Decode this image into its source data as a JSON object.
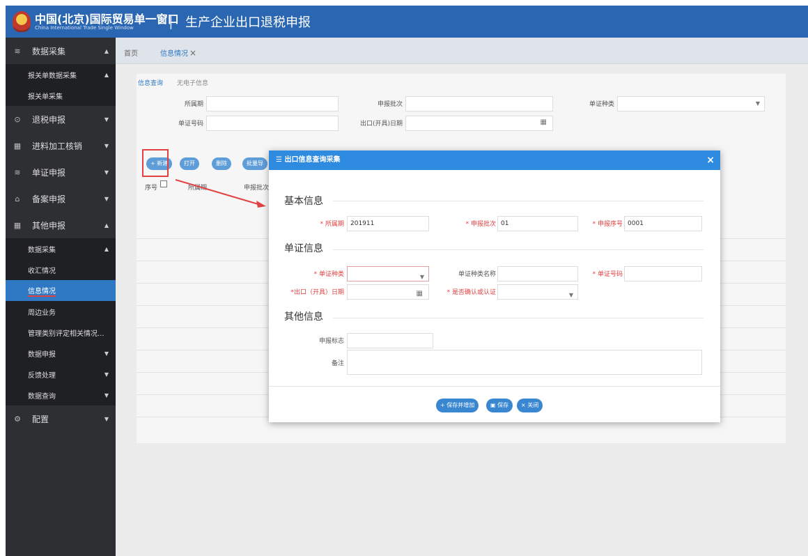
{
  "header": {
    "brand_cn": "中国(北京)国际贸易单一窗口",
    "brand_en": "China International Trade Single Window",
    "separator": "|",
    "subtitle": "生产企业出口退税申报"
  },
  "sidebar": {
    "items": [
      {
        "label": "数据采集",
        "level": 1,
        "icon": "database-icon",
        "arrow": "▲"
      },
      {
        "label": "报关单数据采集",
        "level": 2,
        "arrow": "▲"
      },
      {
        "label": "报关单采集",
        "level": 2
      },
      {
        "label": "退税申报",
        "level": 1,
        "icon": "refund-icon",
        "arrow": "▼"
      },
      {
        "label": "进料加工核销",
        "level": 1,
        "icon": "grid-icon",
        "arrow": "▼"
      },
      {
        "label": "单证申报",
        "level": 1,
        "icon": "database-icon",
        "arrow": "▼"
      },
      {
        "label": "备案申报",
        "level": 1,
        "icon": "bank-icon",
        "arrow": "▼"
      },
      {
        "label": "其他申报",
        "level": 1,
        "icon": "grid-icon",
        "arrow": "▲"
      },
      {
        "label": "数据采集",
        "level": 2,
        "arrow": "▲"
      },
      {
        "label": "收汇情况",
        "level": 2
      },
      {
        "label": "信息情况",
        "level": 2,
        "active": true
      },
      {
        "label": "周边业务",
        "level": 2
      },
      {
        "label": "管理类别评定相关情况...",
        "level": 2
      },
      {
        "label": "数据申报",
        "level": 2,
        "arrow": "▼"
      },
      {
        "label": "反馈处理",
        "level": 2,
        "arrow": "▼"
      },
      {
        "label": "数据查询",
        "level": 2,
        "arrow": "▼"
      },
      {
        "label": "配置",
        "level": 1,
        "icon": "gear-icon",
        "arrow": "▼"
      }
    ]
  },
  "tabs": {
    "home": "首页",
    "active": "信息情况",
    "close": "×"
  },
  "panel": {
    "subtabs": [
      "信息查询",
      "无电子信息"
    ],
    "filters": {
      "period": "所属期",
      "batch": "申报批次",
      "doc_type": "单证种类",
      "doc_no": "单证号码",
      "export_date": "出口(开具)日期"
    },
    "toolbar": {
      "new": "+ 新建",
      "open": "打开",
      "delete": "删除",
      "batch": "批量导"
    },
    "columns": [
      "序号",
      "所属期",
      "申报批次"
    ]
  },
  "modal": {
    "title": "☰ 出口信息查询采集",
    "close": "×",
    "sections": {
      "basic": "基本信息",
      "doc": "单证信息",
      "other": "其他信息"
    },
    "fields": {
      "period_label": "* 所属期",
      "period_value": "201911",
      "batch_label": "* 申报批次",
      "batch_value": "01",
      "seq_label": "* 申报序号",
      "seq_value": "0001",
      "doc_type_label": "* 单证种类",
      "doc_type_name_label": "单证种类名称",
      "doc_no_label": "* 单证号码",
      "export_date_label": "*出口（开具）日期",
      "confirm_label": "* 是否确认或认证",
      "flag_label": "申报标志",
      "remark_label": "备注"
    },
    "buttons": {
      "save_add": "+ 保存并增加",
      "save": "保存",
      "close": "× 关闭"
    }
  },
  "colors": {
    "header": "#2a66b1",
    "sidebar": "#2d2f33",
    "accent": "#2f78c4",
    "highlight": "#e24141"
  }
}
